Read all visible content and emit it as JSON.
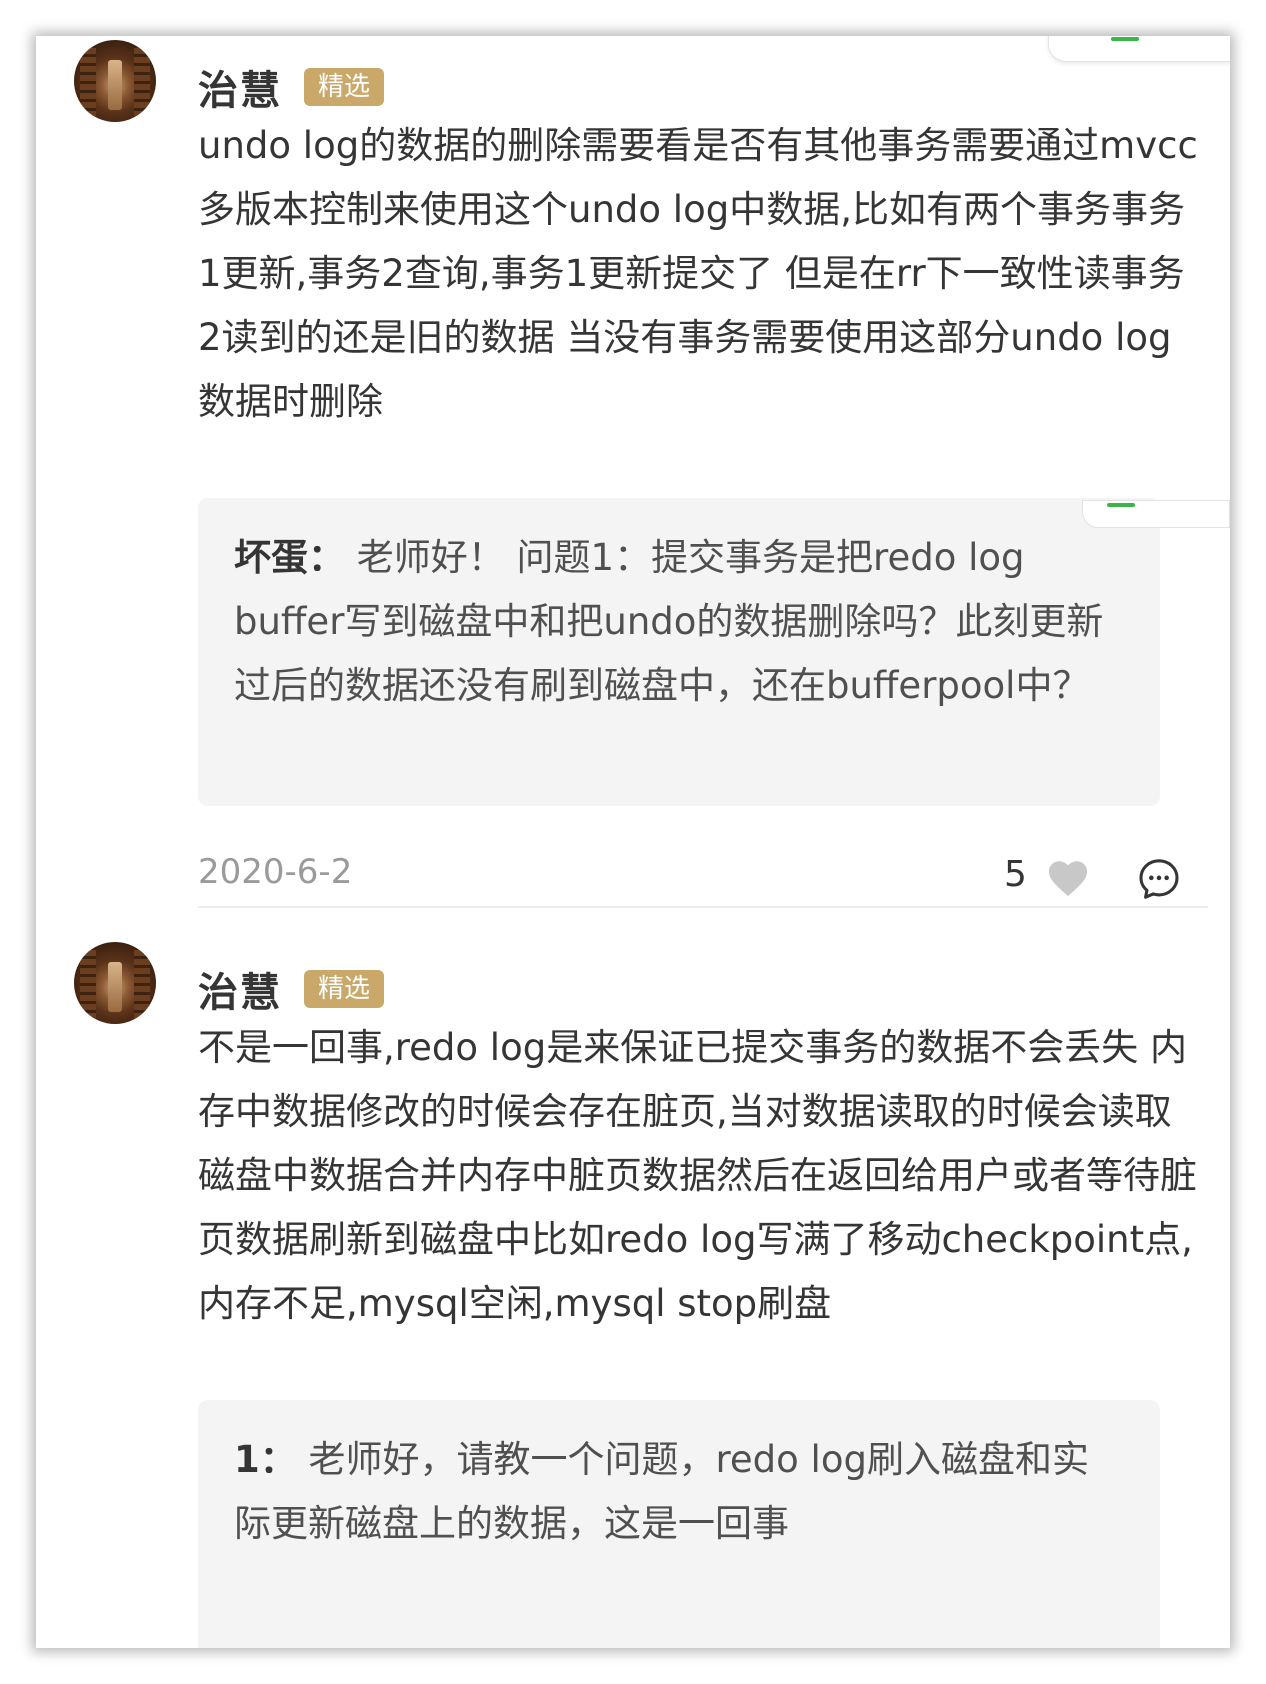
{
  "comments": [
    {
      "author": "治慧",
      "badge": "精选",
      "text": "undo log的数据的删除需要看是否有其他事务需要通过mvcc多版本控制来使用这个undo log中数据,比如有两个事务事务1更新,事务2查询,事务1更新提交了 但是在rr下一致性读事务2读到的还是旧的数据 当没有事务需要使用这部分undo log数据时删除",
      "reply": {
        "author": "坏蛋：",
        "text": " 老师好！ 问题1：提交事务是把redo log buffer写到磁盘中和把undo的数据删除吗？此刻更新过后的数据还没有刷到磁盘中，还在bufferpool中？"
      },
      "date": "2020-6-2",
      "likes": "5"
    },
    {
      "author": "治慧",
      "badge": "精选",
      "text": "不是一回事,redo log是来保证已提交事务的数据不会丢失 内存中数据修改的时候会存在脏页,当对数据读取的时候会读取磁盘中数据合并内存中脏页数据然后在返回给用户或者等待脏页数据刷新到磁盘中比如redo log写满了移动checkpoint点,内存不足,mysql空闲,mysql stop刷盘",
      "reply": {
        "author": "1：",
        "text": " 老师好，请教一个问题，redo log刷入磁盘和实际更新磁盘上的数据，这是一回事"
      }
    }
  ],
  "colors": {
    "badge": "#c9a86a",
    "like_icon": "#c8c8c8",
    "meta_text": "#9a9a9a",
    "reply_bg": "#f4f4f4"
  },
  "icons": [
    "heart-icon",
    "comment-icon"
  ]
}
